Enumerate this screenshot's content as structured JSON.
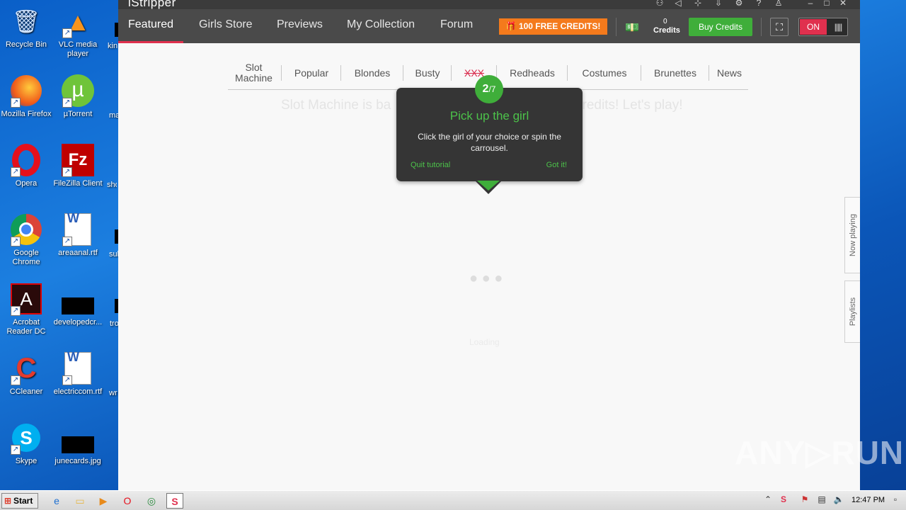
{
  "desktop": {
    "icons": [
      {
        "label": "Recycle Bin",
        "glyph": "🗑"
      },
      {
        "label": "VLC media player",
        "glyph": "▲"
      },
      {
        "label": "Mozilla Firefox",
        "glyph": "●"
      },
      {
        "label": "µTorrent",
        "glyph": "µ"
      },
      {
        "label": "Opera",
        "glyph": "O"
      },
      {
        "label": "FileZilla Client",
        "glyph": "Fz"
      },
      {
        "label": "Google Chrome",
        "glyph": "◎"
      },
      {
        "label": "areaanal.rtf",
        "glyph": "W"
      },
      {
        "label": "Acrobat Reader DC",
        "glyph": "A"
      },
      {
        "label": "developedcr...",
        "glyph": ""
      },
      {
        "label": "CCleaner",
        "glyph": "C"
      },
      {
        "label": "electriccom.rtf",
        "glyph": "W"
      },
      {
        "label": "Skype",
        "glyph": "S"
      },
      {
        "label": "junecards.jpg",
        "glyph": ""
      }
    ],
    "cut_labels": [
      "kin",
      "ma",
      "sho",
      "sub",
      "tro",
      "wr"
    ]
  },
  "app": {
    "logo": "iStripper",
    "nav": [
      "Featured",
      "Girls Store",
      "Previews",
      "My Collection",
      "Forum"
    ],
    "free_credits": "100 FREE CREDITS!",
    "credits_count": "0",
    "credits_label": "Credits",
    "buy_credits": "Buy Credits",
    "toggle_on": "ON",
    "categories": [
      "Slot Machine",
      "Popular",
      "Blondes",
      "Busty",
      "XXX",
      "Redheads",
      "Costumes",
      "Brunettes",
      "News"
    ],
    "ghost_text_left": "Slot Machine is ba",
    "ghost_text_right": "credits! Let's play!",
    "loading_text": "Loading",
    "side_tabs": [
      "Now playing",
      "Playlists"
    ]
  },
  "tutorial": {
    "step_current": "2",
    "step_total": "/7",
    "title": "Pick up the girl",
    "description": "Click the girl of your choice or spin the carrousel.",
    "quit": "Quit tutorial",
    "got": "Got it!"
  },
  "watermark": "ANY▷RUN",
  "taskbar": {
    "start": "Start",
    "clock": "12:47 PM"
  },
  "colors": {
    "accent_red": "#e0304e",
    "accent_green": "#3fae3a",
    "accent_orange": "#f47a1c"
  }
}
